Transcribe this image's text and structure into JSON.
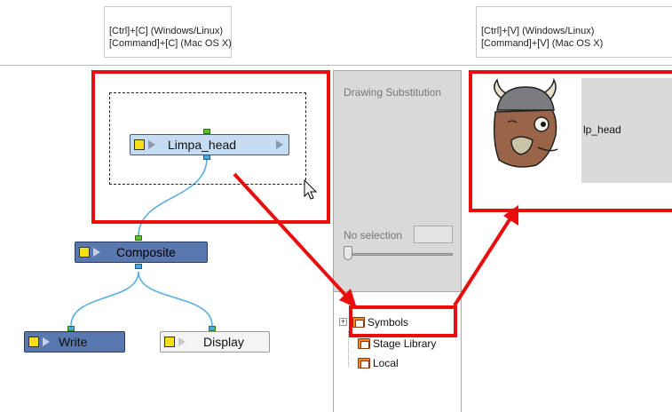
{
  "shortcuts": {
    "copy": {
      "line1": "[Ctrl]+[C] (Windows/Linux)",
      "line2": "[Command]+[C] (Mac OS X)"
    },
    "paste": {
      "line1": "[Ctrl]+[V] (Windows/Linux)",
      "line2": "[Command]+[V] (Mac OS X)"
    }
  },
  "nodes": {
    "head": "Limpa_head",
    "composite": "Composite",
    "write": "Write",
    "display": "Display"
  },
  "drawing_substitution": {
    "title": "Drawing Substitution",
    "selection_label": "No selection",
    "selection_value": "",
    "slider_level": 0
  },
  "library_tree": {
    "items": [
      "Symbols",
      "Stage Library",
      "Local"
    ]
  },
  "symbol_preview": {
    "name": "lp_head"
  },
  "colors": {
    "highlight": "#e80e0e",
    "node_blue": "#c6dcf2",
    "node_dark": "#5a78b0",
    "connector": "#5aaee0"
  },
  "icons": [
    "yellow-square-icon",
    "play-triangle-icon",
    "folder-icon",
    "expand-plus-icon",
    "mouse-cursor-icon",
    "arrow-icon"
  ]
}
